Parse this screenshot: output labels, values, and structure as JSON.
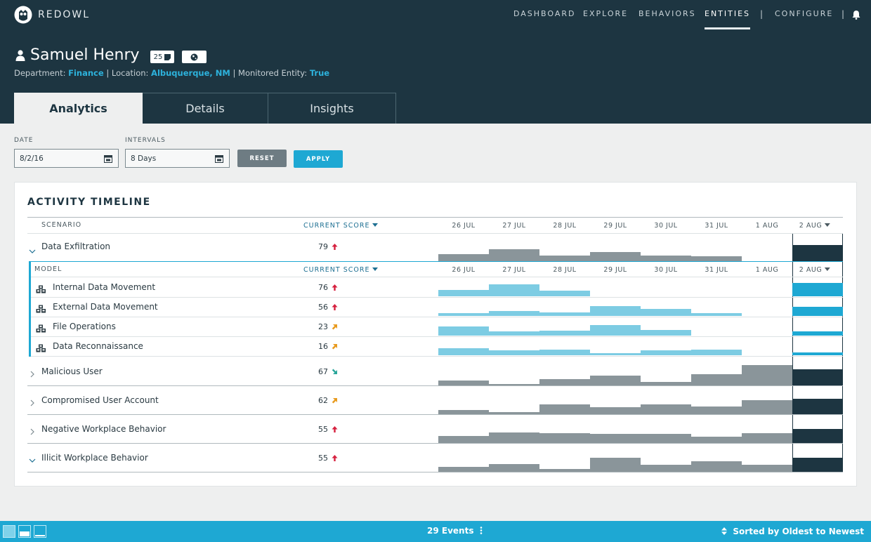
{
  "app": {
    "brand": "REDOWL"
  },
  "nav": {
    "items": [
      "DASHBOARD",
      "EXPLORE",
      "BEHAVIORS",
      "ENTITIES",
      "CONFIGURE"
    ],
    "active": "ENTITIES"
  },
  "entity": {
    "name": "Samuel Henry",
    "badge_count": "25",
    "department_label": "Department:",
    "department": "Finance",
    "location_label": "Location:",
    "location": "Albuquerque, NM",
    "monitored_label": "Monitored Entity:",
    "monitored": "True"
  },
  "tabs": [
    "Analytics",
    "Details",
    "Insights"
  ],
  "filters": {
    "date_label": "DATE",
    "date_value": "8/2/16",
    "intervals_label": "INTERVALS",
    "intervals_value": "8 Days",
    "reset_label": "RESET",
    "apply_label": "APPLY"
  },
  "timeline": {
    "title": "ACTIVITY TIMELINE",
    "scenario_header": "SCENARIO",
    "model_header": "MODEL",
    "score_header": "CURRENT SCORE",
    "dates": [
      "26 JUL",
      "27 JUL",
      "28 JUL",
      "29 JUL",
      "30 JUL",
      "31 JUL",
      "1 AUG",
      "2 AUG"
    ],
    "scenarios": [
      {
        "name": "Data Exfiltration",
        "score": "79",
        "trend": "up",
        "expanded": true,
        "activity": [
          0.33,
          0.55,
          0.28,
          0.44,
          0.28,
          0.22,
          0.0,
          0.75
        ]
      },
      {
        "name": "Malicious User",
        "score": "67",
        "trend": "down-right",
        "expanded": false,
        "activity": [
          0.2,
          0.05,
          0.25,
          0.42,
          0.15,
          0.48,
          0.85,
          0.68
        ]
      },
      {
        "name": "Compromised User Account",
        "score": "62",
        "trend": "up-right",
        "expanded": false,
        "activity": [
          0.18,
          0.1,
          0.4,
          0.3,
          0.4,
          0.32,
          0.6,
          0.65
        ]
      },
      {
        "name": "Negative Workplace Behavior",
        "score": "55",
        "trend": "up",
        "expanded": false,
        "activity": [
          0.3,
          0.45,
          0.42,
          0.38,
          0.38,
          0.25,
          0.4,
          0.6
        ]
      },
      {
        "name": "Illicit Workplace Behavior",
        "score": "55",
        "trend": "up",
        "expanded": true,
        "activity": [
          0.22,
          0.32,
          0.12,
          0.6,
          0.28,
          0.45,
          0.28,
          0.6
        ]
      }
    ],
    "models": [
      {
        "name": "Internal Data Movement",
        "score": "76",
        "trend": "up",
        "activity": [
          0.4,
          0.75,
          0.35,
          0.0,
          0.0,
          0.0,
          0.0,
          0.85
        ]
      },
      {
        "name": "External Data Movement",
        "score": "56",
        "trend": "up",
        "activity": [
          0.18,
          0.33,
          0.22,
          0.65,
          0.45,
          0.18,
          0.0,
          0.6
        ]
      },
      {
        "name": "File Operations",
        "score": "23",
        "trend": "up-right",
        "activity": [
          0.6,
          0.28,
          0.3,
          0.68,
          0.35,
          0.0,
          0.0,
          0.25
        ]
      },
      {
        "name": "Data Reconnaissance",
        "score": "16",
        "trend": "up-right",
        "activity": [
          0.45,
          0.3,
          0.35,
          0.15,
          0.3,
          0.35,
          0.0,
          0.18
        ]
      }
    ]
  },
  "footer": {
    "events": "29 Events",
    "sorted": "Sorted by Oldest to Newest"
  },
  "colors": {
    "header": "#1d3541",
    "accent": "#1ea8d3",
    "link": "#2db2dc",
    "trend_up": "#d6203e",
    "trend_up_right": "#e89a1e",
    "trend_down_right": "#2aa69a"
  }
}
